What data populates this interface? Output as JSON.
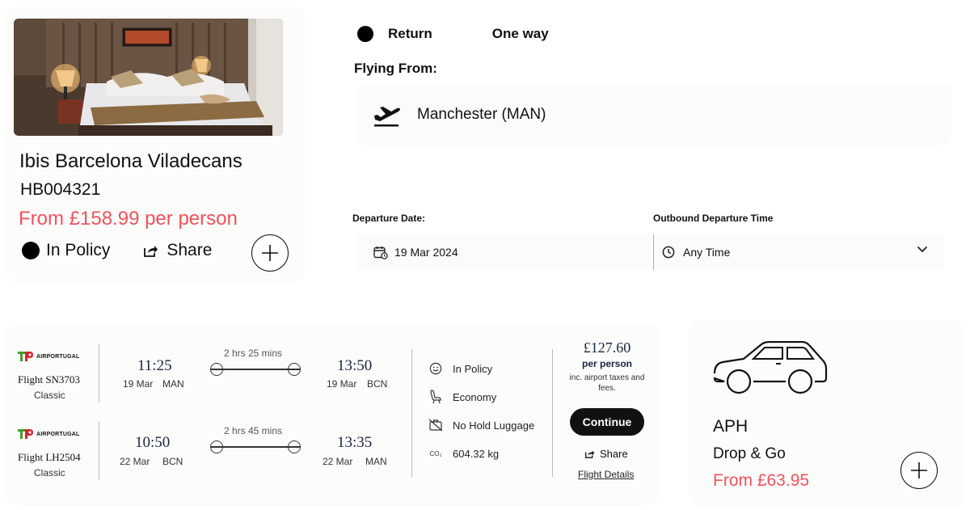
{
  "hotel": {
    "name": "Ibis Barcelona Viladecans",
    "code": "HB004321",
    "price": "From £158.99 per person",
    "policy_label": "In Policy",
    "share_label": "Share"
  },
  "search": {
    "trip_options": [
      "Return",
      "One way"
    ],
    "flying_from_label": "Flying From:",
    "flying_from_value": "Manchester (MAN)",
    "departure_date_label": "Departure Date:",
    "departure_date_value": "19 Mar 2024",
    "outbound_time_label": "Outbound Departure Time",
    "outbound_time_value": "Any Time"
  },
  "flight": {
    "legs": [
      {
        "airline": "AIRPORTUGAL",
        "flight_no": "Flight SN3703",
        "cabin": "Classic",
        "dep_time": "11:25",
        "dep_date": "19 Mar",
        "dep_airport": "MAN",
        "duration": "2 hrs 25 mins",
        "arr_time": "13:50",
        "arr_date": "19 Mar",
        "arr_airport": "BCN"
      },
      {
        "airline": "AIRPORTUGAL",
        "flight_no": "Flight LH2504",
        "cabin": "Classic",
        "dep_time": "10:50",
        "dep_date": "22 Mar",
        "dep_airport": "BCN",
        "duration": "2 hrs 45 mins",
        "arr_time": "13:35",
        "arr_date": "22 Mar",
        "arr_airport": "MAN"
      }
    ],
    "info": {
      "policy": "In Policy",
      "cabin_class": "Economy",
      "luggage": "No Hold Luggage",
      "co2_icon_text": "CO₂",
      "co2": "604.32 kg"
    },
    "price": "£127.60",
    "per_person": "per person",
    "taxes_note": "inc. airport taxes and fees.",
    "continue_label": "Continue",
    "share_label": "Share",
    "details_label": "Flight Details"
  },
  "parking": {
    "name": "APH",
    "product": "Drop & Go",
    "price": "From £63.95"
  },
  "colors": {
    "accent_red": "#f0525a",
    "dark_navy": "#1a2540",
    "tap_green": "#4a9a2e",
    "tap_red": "#d8262e"
  },
  "icons": [
    "hotel-photo",
    "policy-dot-icon",
    "share-icon",
    "plus-icon",
    "plane-departure-icon",
    "calendar-icon",
    "clock-icon",
    "chevron-down-icon",
    "tap-logo",
    "smiley-icon",
    "seat-icon",
    "no-luggage-icon",
    "co2-icon",
    "car-icon"
  ]
}
